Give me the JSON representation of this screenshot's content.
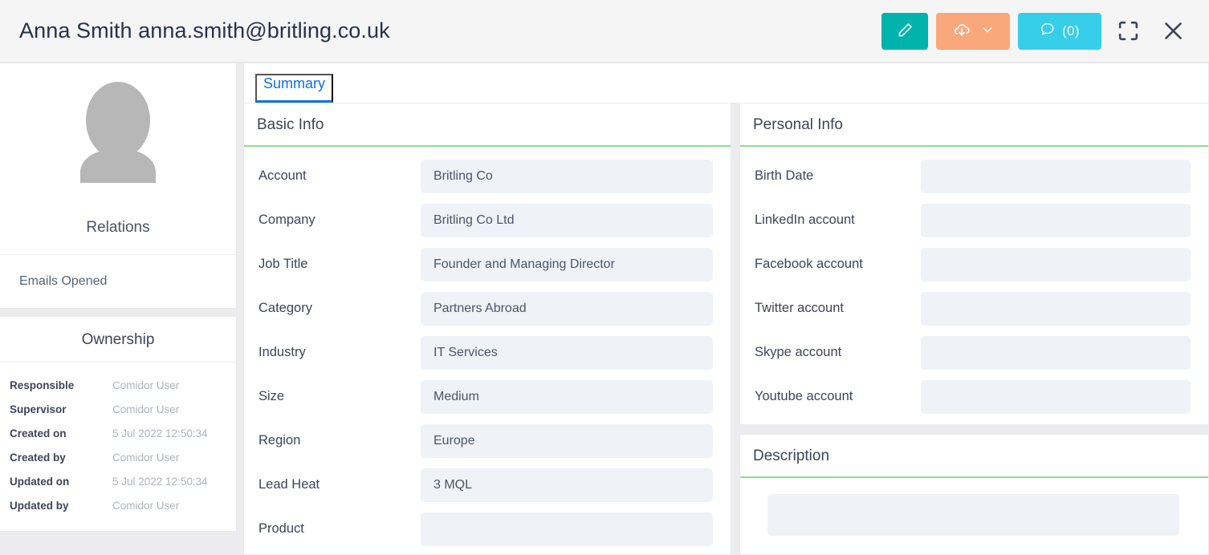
{
  "header": {
    "title": "Anna Smith anna.smith@britling.co.uk",
    "actions": {
      "edit_label": "edit-pencil",
      "download_label": "cloud-download",
      "chat_count": "(0)",
      "fullscreen_label": "fullscreen",
      "close_label": "close"
    },
    "colors": {
      "edit": "#00b3ab",
      "download": "#f9a87c",
      "chat": "#36cee9",
      "tab_accent": "#1270e0",
      "section_accent": "#8fdc8f"
    }
  },
  "sidebar": {
    "relations_title": "Relations",
    "relations": [
      {
        "label": "Emails Opened"
      }
    ],
    "ownership_title": "Ownership",
    "ownership": [
      {
        "label": "Responsible",
        "value": "Comidor User"
      },
      {
        "label": "Supervisor",
        "value": "Comidor User"
      },
      {
        "label": "Created on",
        "value": "5 Jul 2022 12:50:34"
      },
      {
        "label": "Created by",
        "value": "Comidor User"
      },
      {
        "label": "Updated on",
        "value": "5 Jul 2022 12:50:34"
      },
      {
        "label": "Updated by",
        "value": "Comidor User"
      }
    ]
  },
  "main": {
    "tabs": [
      {
        "label": "Summary",
        "active": true
      }
    ],
    "basic_info": {
      "title": "Basic Info",
      "fields": [
        {
          "label": "Account",
          "value": "Britling Co"
        },
        {
          "label": "Company",
          "value": "Britling Co Ltd"
        },
        {
          "label": "Job Title",
          "value": "Founder and Managing Director"
        },
        {
          "label": "Category",
          "value": "Partners Abroad"
        },
        {
          "label": "Industry",
          "value": "IT Services"
        },
        {
          "label": "Size",
          "value": "Medium"
        },
        {
          "label": "Region",
          "value": "Europe"
        },
        {
          "label": "Lead Heat",
          "value": "3 MQL"
        },
        {
          "label": "Product",
          "value": ""
        }
      ]
    },
    "personal_info": {
      "title": "Personal Info",
      "fields": [
        {
          "label": "Birth Date",
          "value": ""
        },
        {
          "label": "LinkedIn account",
          "value": ""
        },
        {
          "label": "Facebook account",
          "value": ""
        },
        {
          "label": "Twitter account",
          "value": ""
        },
        {
          "label": "Skype account",
          "value": ""
        },
        {
          "label": "Youtube account",
          "value": ""
        }
      ]
    },
    "description": {
      "title": "Description",
      "value": ""
    }
  }
}
